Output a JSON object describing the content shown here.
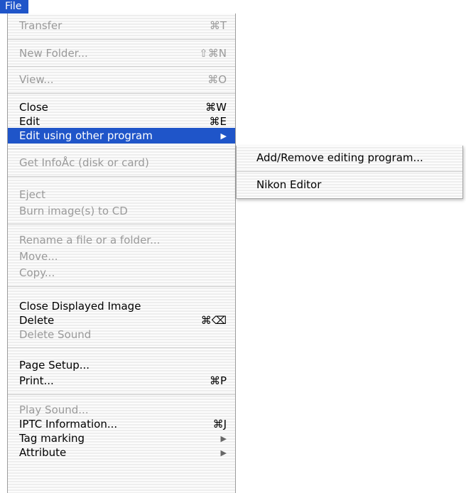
{
  "menubar": {
    "title": "File"
  },
  "menu": {
    "items": [
      {
        "label": "Transfer",
        "shortcut": "⌘T",
        "enabled": false
      },
      {
        "label": "New Folder...",
        "shortcut": "⇧⌘N",
        "enabled": false
      },
      {
        "label": "View...",
        "shortcut": "⌘O",
        "enabled": false
      },
      {
        "label": "Close",
        "shortcut": "⌘W",
        "enabled": true
      },
      {
        "label": "Edit",
        "shortcut": "⌘E",
        "enabled": true
      },
      {
        "label": "Edit using other program",
        "shortcut": "▶",
        "enabled": true,
        "selected": true
      },
      {
        "label": "Get InfoÅc (disk or card)",
        "shortcut": "",
        "enabled": false
      },
      {
        "label": "Eject",
        "shortcut": "",
        "enabled": false
      },
      {
        "label": "Burn image(s) to CD",
        "shortcut": "",
        "enabled": false
      },
      {
        "label": "Rename a file or a folder...",
        "shortcut": "",
        "enabled": false
      },
      {
        "label": "Move...",
        "shortcut": "",
        "enabled": false
      },
      {
        "label": "Copy...",
        "shortcut": "",
        "enabled": false
      },
      {
        "label": "Close Displayed Image",
        "shortcut": "",
        "enabled": true
      },
      {
        "label": "Delete",
        "shortcut": "⌘⌫",
        "enabled": true
      },
      {
        "label": "Delete Sound",
        "shortcut": "",
        "enabled": false
      },
      {
        "label": "Page Setup...",
        "shortcut": "",
        "enabled": true
      },
      {
        "label": "Print...",
        "shortcut": "⌘P",
        "enabled": true
      },
      {
        "label": "Play Sound...",
        "shortcut": "",
        "enabled": false
      },
      {
        "label": "IPTC Information...",
        "shortcut": "⌘J",
        "enabled": true
      },
      {
        "label": "Tag marking",
        "shortcut": "▶",
        "enabled": true
      },
      {
        "label": "Attribute",
        "shortcut": "▶",
        "enabled": true
      }
    ]
  },
  "submenu": {
    "items": [
      {
        "label": "Add/Remove editing program..."
      },
      {
        "label": "Nikon Editor"
      }
    ]
  }
}
